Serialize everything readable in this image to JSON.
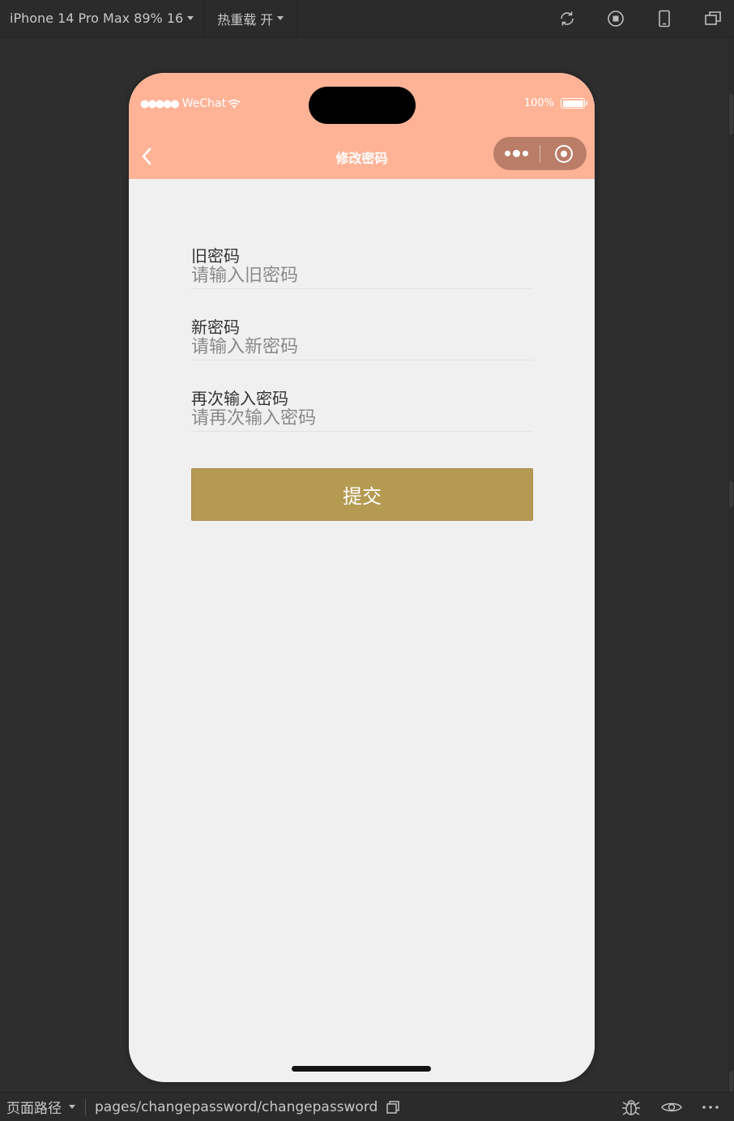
{
  "toolbar": {
    "device_label": "iPhone 14 Pro Max 89% 16",
    "hot_reload_label": "热重载 开",
    "icons": [
      "refresh-icon",
      "stop-icon",
      "phone-icon",
      "window-icon"
    ]
  },
  "phone": {
    "status": {
      "carrier": "WeChat",
      "battery_text": "100%"
    },
    "nav": {
      "title": "修改密码",
      "back_icon": "chevron-left-icon",
      "more_icon": "more-dots-icon",
      "close_icon": "target-icon"
    },
    "form": {
      "old_password": {
        "label": "旧密码",
        "placeholder": "请输入旧密码"
      },
      "new_password": {
        "label": "新密码",
        "placeholder": "请输入新密码"
      },
      "confirm_password": {
        "label": "再次输入密码",
        "placeholder": "请再次输入密码"
      },
      "submit_label": "提交"
    }
  },
  "bottombar": {
    "path_label": "页面路径",
    "path": "pages/changepassword/changepassword",
    "icons": [
      "bug-icon",
      "eye-icon",
      "more-icon"
    ]
  },
  "colors": {
    "header_bg": "#ffb396",
    "page_bg": "#f0f0f0",
    "submit_bg": "#b59a52",
    "ide_bg": "#2e2e2e"
  }
}
